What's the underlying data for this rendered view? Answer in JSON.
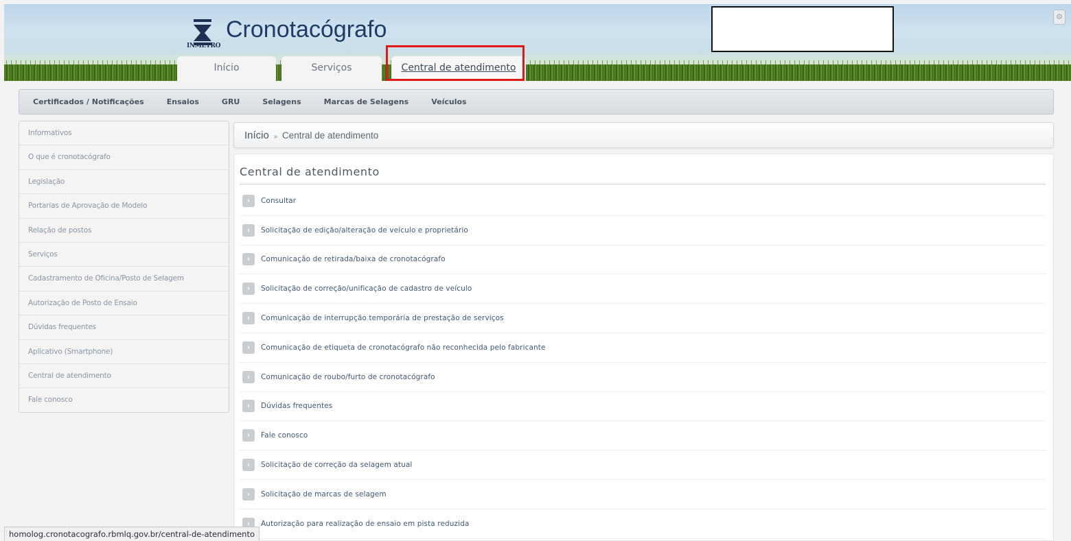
{
  "header": {
    "logo_text": "INMETRO",
    "site_title": "Cronotacógrafo",
    "corner_icon": "gear-icon",
    "tabs": [
      {
        "label": "Início"
      },
      {
        "label": "Serviços"
      },
      {
        "label": "Central de atendimento"
      }
    ]
  },
  "subnav": {
    "items": [
      {
        "label": "Certificados / Notificações"
      },
      {
        "label": "Ensaios"
      },
      {
        "label": "GRU"
      },
      {
        "label": "Selagens"
      },
      {
        "label": "Marcas de Selagens"
      },
      {
        "label": "Veículos"
      }
    ]
  },
  "sidebar": {
    "items": [
      {
        "label": "Informativos"
      },
      {
        "label": "O que é cronotacógrafo"
      },
      {
        "label": "Legislação"
      },
      {
        "label": "Portarias de Aprovação de Modelo"
      },
      {
        "label": "Relação de postos"
      },
      {
        "label": "Serviços"
      },
      {
        "label": "Cadastramento de Oficina/Posto de Selagem"
      },
      {
        "label": "Autorização de Posto de Ensaio"
      },
      {
        "label": "Dúvidas frequentes"
      },
      {
        "label": "Aplicativo (Smartphone)"
      },
      {
        "label": "Central de atendimento"
      },
      {
        "label": "Fale conosco"
      }
    ]
  },
  "breadcrumb": {
    "home": "Início",
    "separator": "»",
    "current": "Central de atendimento"
  },
  "main": {
    "title": "Central de atendimento",
    "services": [
      {
        "label": "Consultar"
      },
      {
        "label": "Solicitação de edição/alteração de veículo e proprietário"
      },
      {
        "label": "Comunicação de retirada/baixa de cronotacógrafo"
      },
      {
        "label": "Solicitação de correção/unificação de cadastro de veículo"
      },
      {
        "label": "Comunicação de interrupção temporária de prestação de serviços"
      },
      {
        "label": "Comunicação de etiqueta de cronotacógrafo não reconhecida pelo fabricante"
      },
      {
        "label": "Comunicação de roubo/furto de cronotacógrafo"
      },
      {
        "label": "Dúvidas frequentes"
      },
      {
        "label": "Fale conosco"
      },
      {
        "label": "Solicitação de correção da selagem atual"
      },
      {
        "label": "Solicitação de marcas de selagem"
      },
      {
        "label": "Autorização para realização de ensaio em pista reduzida"
      }
    ]
  },
  "statusbar": {
    "url": "homolog.cronotacografo.rbmlq.gov.br/central-de-atendimento"
  }
}
